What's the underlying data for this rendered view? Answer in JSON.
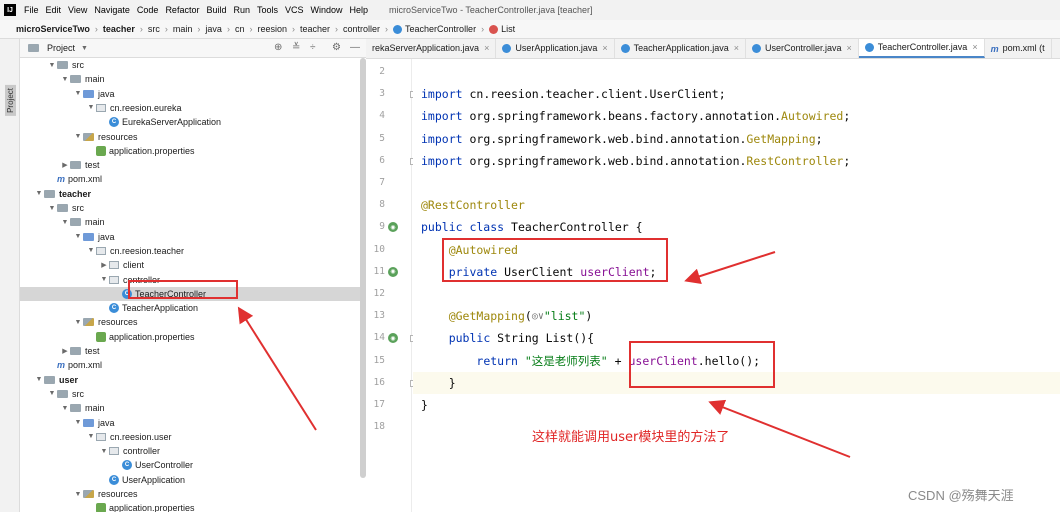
{
  "app": {
    "logo": "IJ",
    "menu": [
      "File",
      "Edit",
      "View",
      "Navigate",
      "Code",
      "Refactor",
      "Build",
      "Run",
      "Tools",
      "VCS",
      "Window",
      "Help"
    ],
    "window_title": "microServiceTwo - TeacherController.java [teacher]"
  },
  "breadcrumb": [
    {
      "label": "microServiceTwo",
      "bold": true
    },
    {
      "label": "teacher",
      "bold": true
    },
    {
      "label": "src"
    },
    {
      "label": "main"
    },
    {
      "label": "java"
    },
    {
      "label": "cn"
    },
    {
      "label": "reesion"
    },
    {
      "label": "teacher"
    },
    {
      "label": "controller"
    },
    {
      "label": "TeacherController",
      "icon": "class-icon"
    },
    {
      "label": "List",
      "icon": "method-icon"
    }
  ],
  "tool_stripe": {
    "label": "Project"
  },
  "project_panel": {
    "title": "Project",
    "tree": [
      {
        "label": "src",
        "indent": 3,
        "arrow": "v",
        "icon": "folder"
      },
      {
        "label": "main",
        "indent": 4,
        "arrow": "v",
        "icon": "folder"
      },
      {
        "label": "java",
        "indent": 5,
        "arrow": "v",
        "icon": "src-folder"
      },
      {
        "label": "cn.reesion.eureka",
        "indent": 6,
        "arrow": "v",
        "icon": "package"
      },
      {
        "label": "EurekaServerApplication",
        "indent": 7,
        "arrow": "",
        "icon": "class"
      },
      {
        "label": "resources",
        "indent": 5,
        "arrow": "v",
        "icon": "res-folder"
      },
      {
        "label": "application.properties",
        "indent": 6,
        "arrow": "",
        "icon": "props"
      },
      {
        "label": "test",
        "indent": 4,
        "arrow": ">",
        "icon": "folder"
      },
      {
        "label": "pom.xml",
        "indent": 3,
        "arrow": "",
        "icon": "maven"
      },
      {
        "label": "teacher",
        "indent": 2,
        "arrow": "v",
        "icon": "folder",
        "bold": true
      },
      {
        "label": "src",
        "indent": 3,
        "arrow": "v",
        "icon": "folder"
      },
      {
        "label": "main",
        "indent": 4,
        "arrow": "v",
        "icon": "folder"
      },
      {
        "label": "java",
        "indent": 5,
        "arrow": "v",
        "icon": "src-folder"
      },
      {
        "label": "cn.reesion.teacher",
        "indent": 6,
        "arrow": "v",
        "icon": "package"
      },
      {
        "label": "client",
        "indent": 7,
        "arrow": ">",
        "icon": "package"
      },
      {
        "label": "controller",
        "indent": 7,
        "arrow": "v",
        "icon": "package"
      },
      {
        "label": "TeacherController",
        "indent": 8,
        "arrow": "",
        "icon": "class",
        "selected": true
      },
      {
        "label": "TeacherApplication",
        "indent": 7,
        "arrow": "",
        "icon": "class"
      },
      {
        "label": "resources",
        "indent": 5,
        "arrow": "v",
        "icon": "res-folder"
      },
      {
        "label": "application.properties",
        "indent": 6,
        "arrow": "",
        "icon": "props"
      },
      {
        "label": "test",
        "indent": 4,
        "arrow": ">",
        "icon": "folder"
      },
      {
        "label": "pom.xml",
        "indent": 3,
        "arrow": "",
        "icon": "maven"
      },
      {
        "label": "user",
        "indent": 2,
        "arrow": "v",
        "icon": "folder",
        "bold": true
      },
      {
        "label": "src",
        "indent": 3,
        "arrow": "v",
        "icon": "folder"
      },
      {
        "label": "main",
        "indent": 4,
        "arrow": "v",
        "icon": "folder"
      },
      {
        "label": "java",
        "indent": 5,
        "arrow": "v",
        "icon": "src-folder"
      },
      {
        "label": "cn.reesion.user",
        "indent": 6,
        "arrow": "v",
        "icon": "package"
      },
      {
        "label": "controller",
        "indent": 7,
        "arrow": "v",
        "icon": "package"
      },
      {
        "label": "UserController",
        "indent": 8,
        "arrow": "",
        "icon": "class"
      },
      {
        "label": "UserApplication",
        "indent": 7,
        "arrow": "",
        "icon": "class"
      },
      {
        "label": "resources",
        "indent": 5,
        "arrow": "v",
        "icon": "res-folder"
      },
      {
        "label": "application.properties",
        "indent": 6,
        "arrow": "",
        "icon": "props"
      }
    ]
  },
  "editor_tabs": [
    {
      "label": "rekaServerApplication.java",
      "active": false
    },
    {
      "label": "UserApplication.java",
      "active": false
    },
    {
      "label": "TeacherApplication.java",
      "active": false
    },
    {
      "label": "UserController.java",
      "active": false
    },
    {
      "label": "TeacherController.java",
      "active": true
    },
    {
      "label": "pom.xml (t",
      "active": false
    }
  ],
  "code_lines": [
    {
      "num": "2",
      "segs": []
    },
    {
      "num": "3",
      "segs": [
        [
          "kw",
          "import "
        ],
        [
          "plain",
          "cn.reesion.teacher.client.UserClient;"
        ]
      ]
    },
    {
      "num": "4",
      "segs": [
        [
          "kw",
          "import "
        ],
        [
          "plain",
          "org.springframework.beans.factory.annotation."
        ],
        [
          "ann-ref",
          "Autowired"
        ],
        [
          "plain",
          ";"
        ]
      ]
    },
    {
      "num": "5",
      "segs": [
        [
          "kw",
          "import "
        ],
        [
          "plain",
          "org.springframework.web.bind.annotation."
        ],
        [
          "ann-ref",
          "GetMapping"
        ],
        [
          "plain",
          ";"
        ]
      ]
    },
    {
      "num": "6",
      "segs": [
        [
          "kw",
          "import "
        ],
        [
          "plain",
          "org.springframework.web.bind.annotation."
        ],
        [
          "ann-ref",
          "RestController"
        ],
        [
          "plain",
          ";"
        ]
      ]
    },
    {
      "num": "7",
      "segs": []
    },
    {
      "num": "8",
      "segs": [
        [
          "ann",
          "@RestController"
        ]
      ]
    },
    {
      "num": "9",
      "segs": [
        [
          "kw",
          "public class "
        ],
        [
          "plain",
          "TeacherController {"
        ]
      ]
    },
    {
      "num": "10",
      "segs": [
        [
          "plain",
          "    "
        ],
        [
          "ann",
          "@Autowired"
        ]
      ]
    },
    {
      "num": "11",
      "segs": [
        [
          "plain",
          "    "
        ],
        [
          "kw",
          "private "
        ],
        [
          "plain",
          "UserClient "
        ],
        [
          "field",
          "userClient"
        ],
        [
          "plain",
          ";"
        ]
      ]
    },
    {
      "num": "12",
      "segs": []
    },
    {
      "num": "13",
      "segs": [
        [
          "plain",
          "    "
        ],
        [
          "ann",
          "@GetMapping"
        ],
        [
          "plain",
          "("
        ],
        [
          "inlay",
          "◎∨"
        ],
        [
          "str",
          "\"list\""
        ],
        [
          "plain",
          ")"
        ]
      ]
    },
    {
      "num": "14",
      "segs": [
        [
          "plain",
          "    "
        ],
        [
          "kw",
          "public "
        ],
        [
          "plain",
          "String List(){"
        ]
      ]
    },
    {
      "num": "15",
      "segs": [
        [
          "plain",
          "        "
        ],
        [
          "kw",
          "return "
        ],
        [
          "str",
          "\"这是老师列表\""
        ],
        [
          "plain",
          " + "
        ],
        [
          "field",
          "userClient"
        ],
        [
          "plain",
          ".hello();"
        ]
      ]
    },
    {
      "num": "16",
      "segs": [
        [
          "plain",
          "    }"
        ]
      ]
    },
    {
      "num": "17",
      "segs": [
        [
          "plain",
          "}"
        ]
      ]
    },
    {
      "num": "18",
      "segs": []
    }
  ],
  "annotation": {
    "text": "这样就能调用user模块里的方法了",
    "color": "#e02424"
  },
  "watermark": "CSDN @殇舞天涯",
  "colors": {
    "highlight_box": "#e03030",
    "selection": "#d6d6d6",
    "keyword": "#0033b3",
    "annotation": "#9e880d",
    "string": "#067d17",
    "field": "#871094"
  }
}
